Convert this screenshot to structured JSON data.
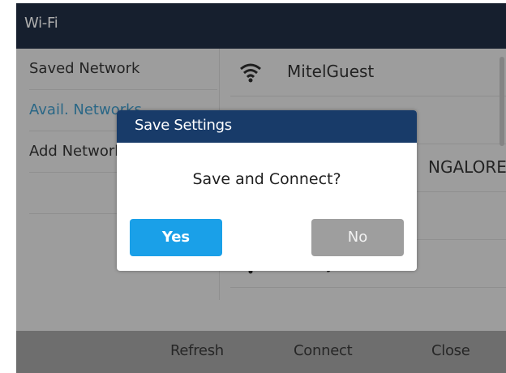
{
  "window": {
    "title": "Wi-Fi"
  },
  "sidebar": {
    "items": [
      {
        "label": "Saved Network",
        "active": false
      },
      {
        "label": "Avail. Networks",
        "active": true
      },
      {
        "label": "Add Network",
        "active": false
      }
    ]
  },
  "networks": [
    {
      "name": "MitelGuest",
      "icon": "wifi-signal-icon"
    },
    {
      "name": "",
      "icon": "wifi-signal-icon"
    },
    {
      "name": "NGALORE",
      "icon": "wifi-signal-icon"
    },
    {
      "name": "",
      "icon": "wifi-signal-icon"
    },
    {
      "name": "venky",
      "icon": "wifi-signal-icon"
    }
  ],
  "softkeys": {
    "refresh": "Refresh",
    "connect": "Connect",
    "close": "Close"
  },
  "dialog": {
    "title": "Save Settings",
    "message": "Save and Connect?",
    "yes_label": "Yes",
    "no_label": "No"
  },
  "colors": {
    "titlebar": "#0c1b33",
    "dialog_header": "#183b69",
    "accent": "#1aa0e8",
    "active_text": "#2c8ec0"
  }
}
